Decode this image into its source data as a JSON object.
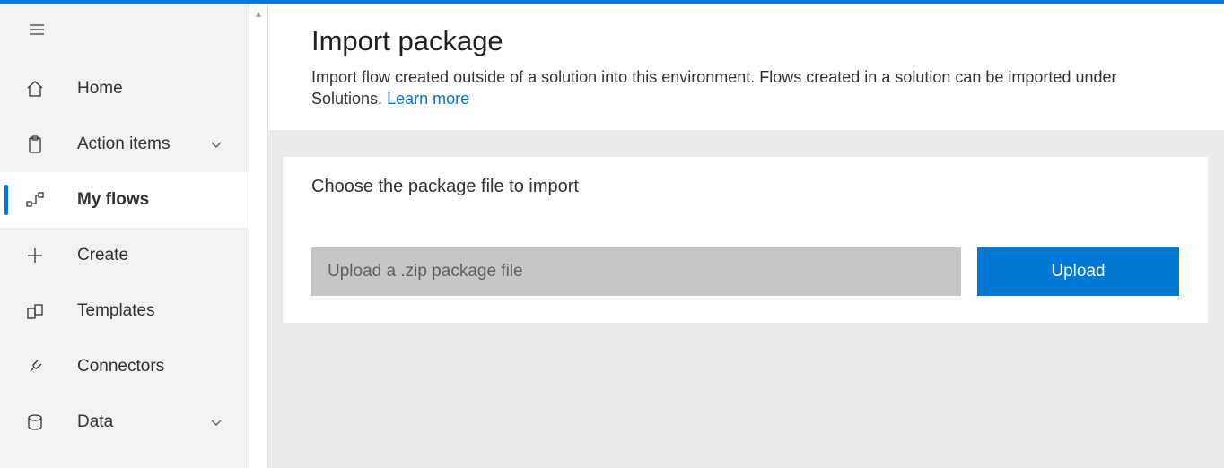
{
  "sidebar": {
    "items": [
      {
        "label": "Home",
        "chevron": false,
        "selected": false
      },
      {
        "label": "Action items",
        "chevron": true,
        "selected": false
      },
      {
        "label": "My flows",
        "chevron": false,
        "selected": true
      },
      {
        "label": "Create",
        "chevron": false,
        "selected": false
      },
      {
        "label": "Templates",
        "chevron": false,
        "selected": false
      },
      {
        "label": "Connectors",
        "chevron": false,
        "selected": false
      },
      {
        "label": "Data",
        "chevron": true,
        "selected": false
      }
    ]
  },
  "main": {
    "title": "Import package",
    "subtitle_a": "Import flow created outside of a solution into this environment. Flows created in a solution can be imported under Solutions. ",
    "learn_more": "Learn more",
    "card_title": "Choose the package file to import",
    "upload_placeholder": "Upload a .zip package file",
    "upload_button": "Upload"
  }
}
